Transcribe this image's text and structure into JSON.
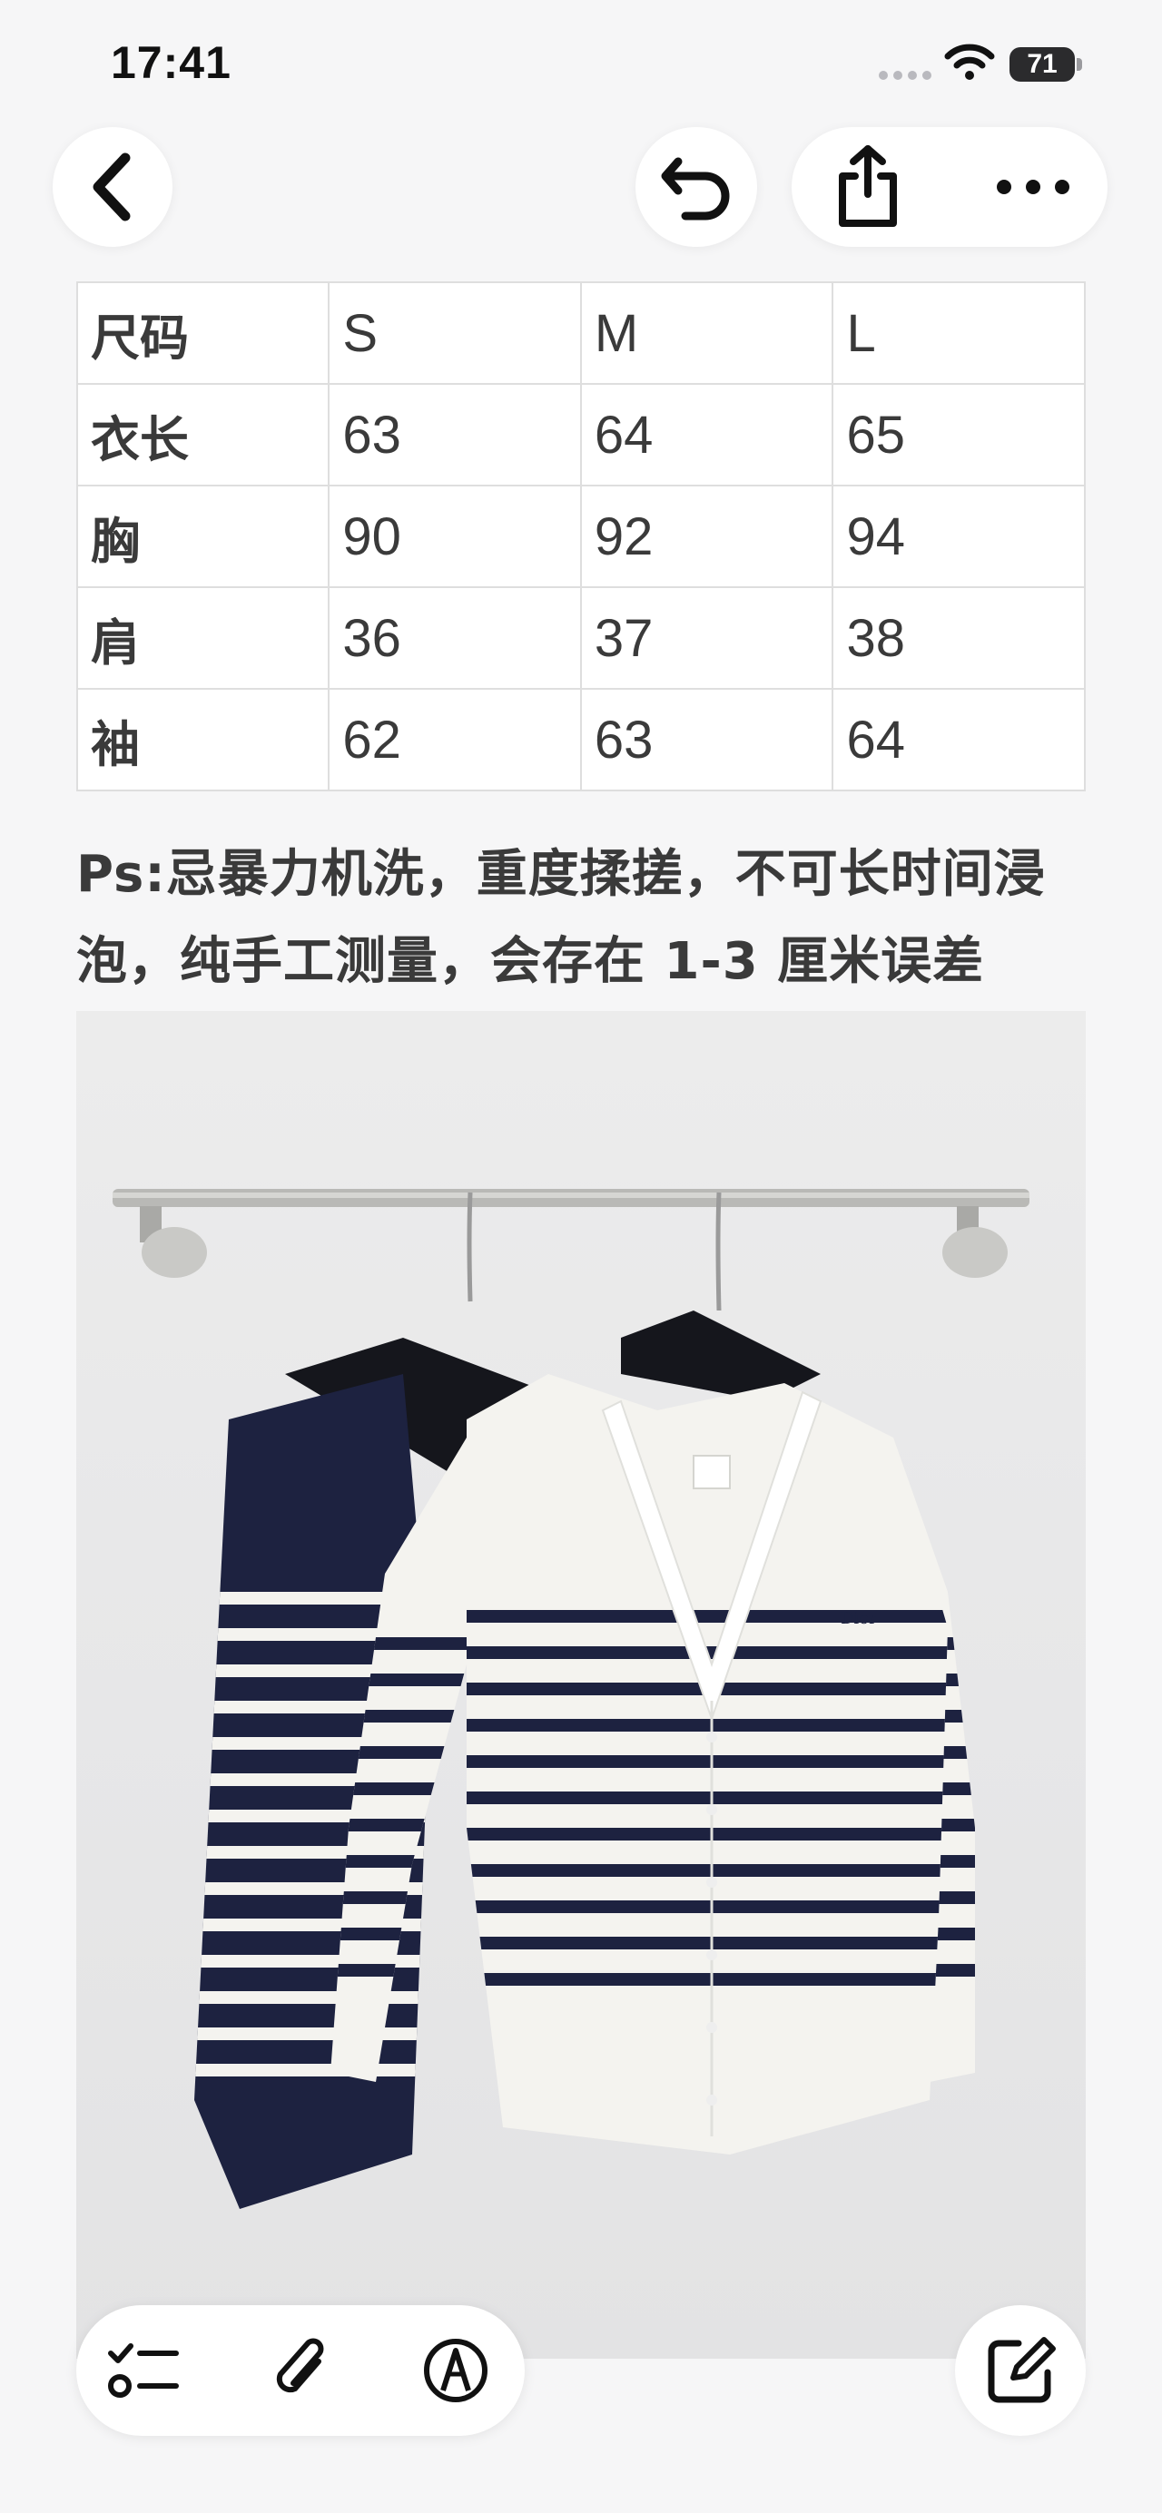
{
  "status": {
    "time": "17:41",
    "battery": "71"
  },
  "nav": {
    "back_icon": "chevron-left-icon",
    "undo_icon": "undo-arrow-icon",
    "share_icon": "share-icon",
    "more_icon": "ellipsis-icon"
  },
  "size_table": {
    "rows": [
      [
        "尺码",
        "S",
        "M",
        "L"
      ],
      [
        "衣长",
        "63",
        "64",
        "65"
      ],
      [
        "胸",
        "90",
        "92",
        "94"
      ],
      [
        "肩",
        "36",
        "37",
        "38"
      ],
      [
        "袖",
        "62",
        "63",
        "64"
      ]
    ]
  },
  "note": {
    "line1": "Ps:忌暴力机洗，重度揉搓，不可长时间浸",
    "line2": "泡，纯手工测量，会存在 1-3 厘米误差"
  },
  "photo": {
    "brand_label": "Dior",
    "colors": {
      "navy": "#1d2240",
      "ivory": "#f4f3ef",
      "wall": "#e9e9ea"
    }
  },
  "toolbar": {
    "checklist_icon": "checklist-icon",
    "attach_icon": "paperclip-icon",
    "markup_icon": "pen-markup-icon",
    "compose_icon": "compose-icon"
  }
}
